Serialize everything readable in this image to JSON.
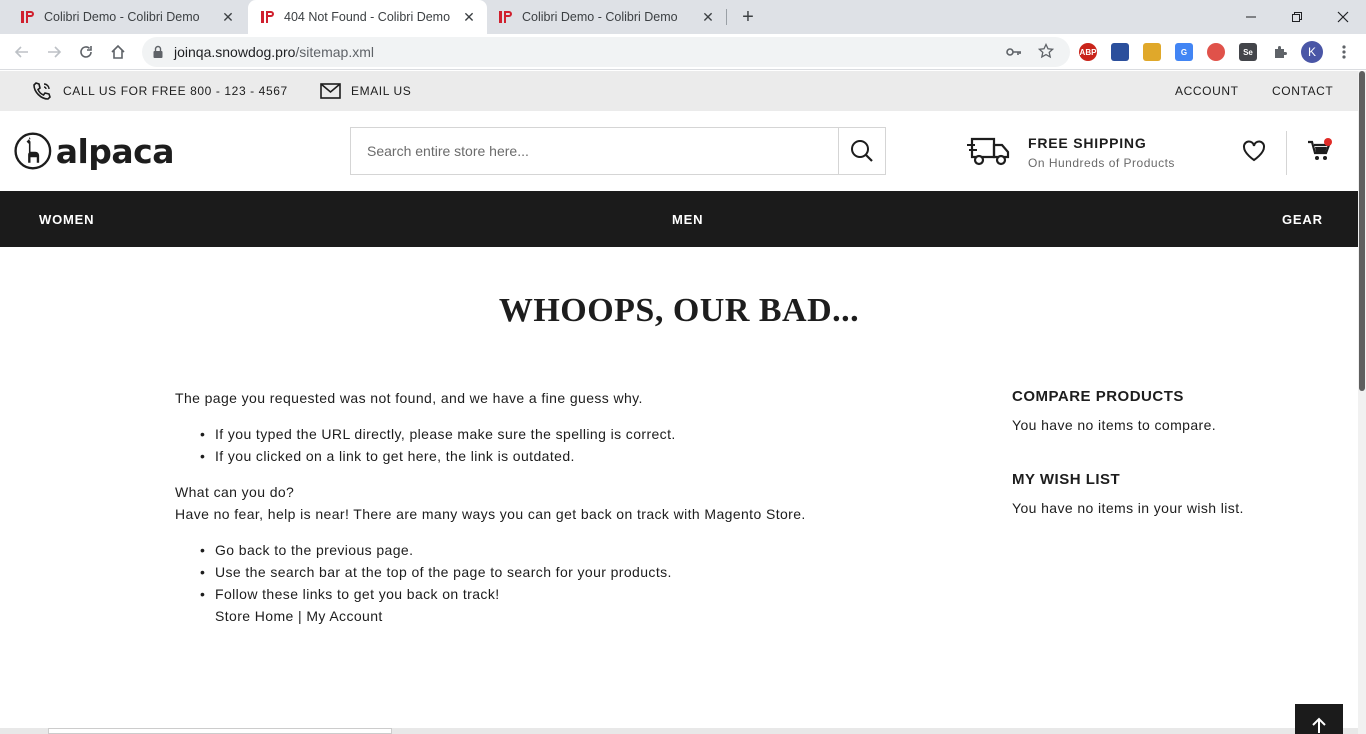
{
  "browser": {
    "tabs": [
      {
        "title": "Colibri Demo - Colibri Demo",
        "active": false
      },
      {
        "title": "404 Not Found - Colibri Demo",
        "active": true
      },
      {
        "title": "Colibri Demo - Colibri Demo",
        "active": false
      }
    ],
    "url_host": "joinqa.snowdog.pro",
    "url_path": "/sitemap.xml",
    "profile_initial": "K",
    "extensions": [
      {
        "name": "abp-icon",
        "label": "ABP",
        "color": "#c9241a"
      },
      {
        "name": "extension-blue-icon",
        "label": "",
        "color": "#2b4f9c"
      },
      {
        "name": "extension-mail-icon",
        "label": "",
        "color": "#e0a82a"
      },
      {
        "name": "translate-icon",
        "label": "G",
        "color": "#4285f4"
      },
      {
        "name": "shield-extension-icon",
        "label": "",
        "color": "#e0524a"
      },
      {
        "name": "selenium-icon",
        "label": "Se",
        "color": "#43454a"
      }
    ]
  },
  "topbar": {
    "phone": "CALL US FOR FREE 800 - 123 - 4567",
    "email": "EMAIL US",
    "account": "ACCOUNT",
    "contact": "CONTACT"
  },
  "header": {
    "logo_text": "alpaca",
    "search_placeholder": "Search entire store here...",
    "shipping_title": "FREE SHIPPING",
    "shipping_sub": "On Hundreds of Products"
  },
  "nav": {
    "women": "WOMEN",
    "men": "MEN",
    "gear": "GEAR"
  },
  "page": {
    "heading": "WHOOPS, OUR BAD...",
    "intro": "The page you requested was not found, and we have a fine guess why.",
    "reasons": [
      "If you typed the URL directly, please make sure the spelling is correct.",
      "If you clicked on a link to get here, the link is outdated."
    ],
    "what_title": "What can you do?",
    "what_text": "Have no fear, help is near! There are many ways you can get back on track with Magento Store.",
    "actions": [
      "Go back to the previous page.",
      "Use the search bar at the top of the page to search for your products.",
      "Follow these links to get you back on track!"
    ],
    "link_home": "Store Home",
    "link_separator": "|",
    "link_account": "My Account"
  },
  "sidebar": {
    "compare_title": "COMPARE PRODUCTS",
    "compare_text": "You have no items to compare.",
    "wishlist_title": "MY WISH LIST",
    "wishlist_text": "You have no items in your wish list."
  },
  "colors": {
    "nav_bg": "#1b1b1b",
    "topbar_bg": "#ebebeb",
    "cart_badge": "#e02b27"
  }
}
